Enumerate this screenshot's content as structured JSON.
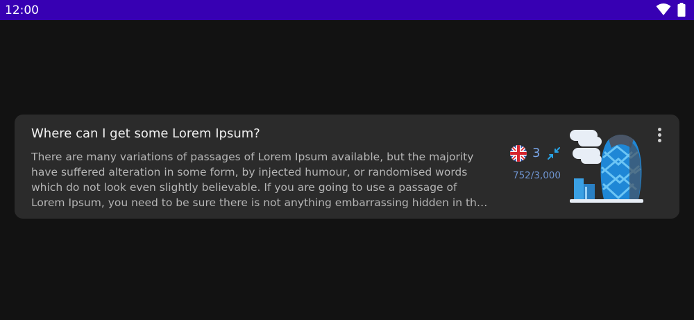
{
  "status_bar": {
    "time": "12:00",
    "icons": [
      "wifi-icon",
      "battery-icon"
    ],
    "color": "#3700b3"
  },
  "card": {
    "title": "Where can I get some Lorem Ipsum?",
    "body": "There are many variations of passages of Lorem Ipsum available, but the majority have suffered alteration in some form, by injected humour, or randomised words which do not look even slightly believable. If you are going to use a passage of Lorem Ipsum, you need to be sure there is not anything embarrassing hidden in the middle of text.",
    "language_icon": "uk-flag-icon",
    "repeat_count": "3",
    "mode_icon": "compress-arrows-icon",
    "progress": "752/3,000",
    "illustration": "london-gherkin-building-illustration",
    "menu_icon": "more-vertical-icon",
    "accent_color": "#78a4e6"
  }
}
